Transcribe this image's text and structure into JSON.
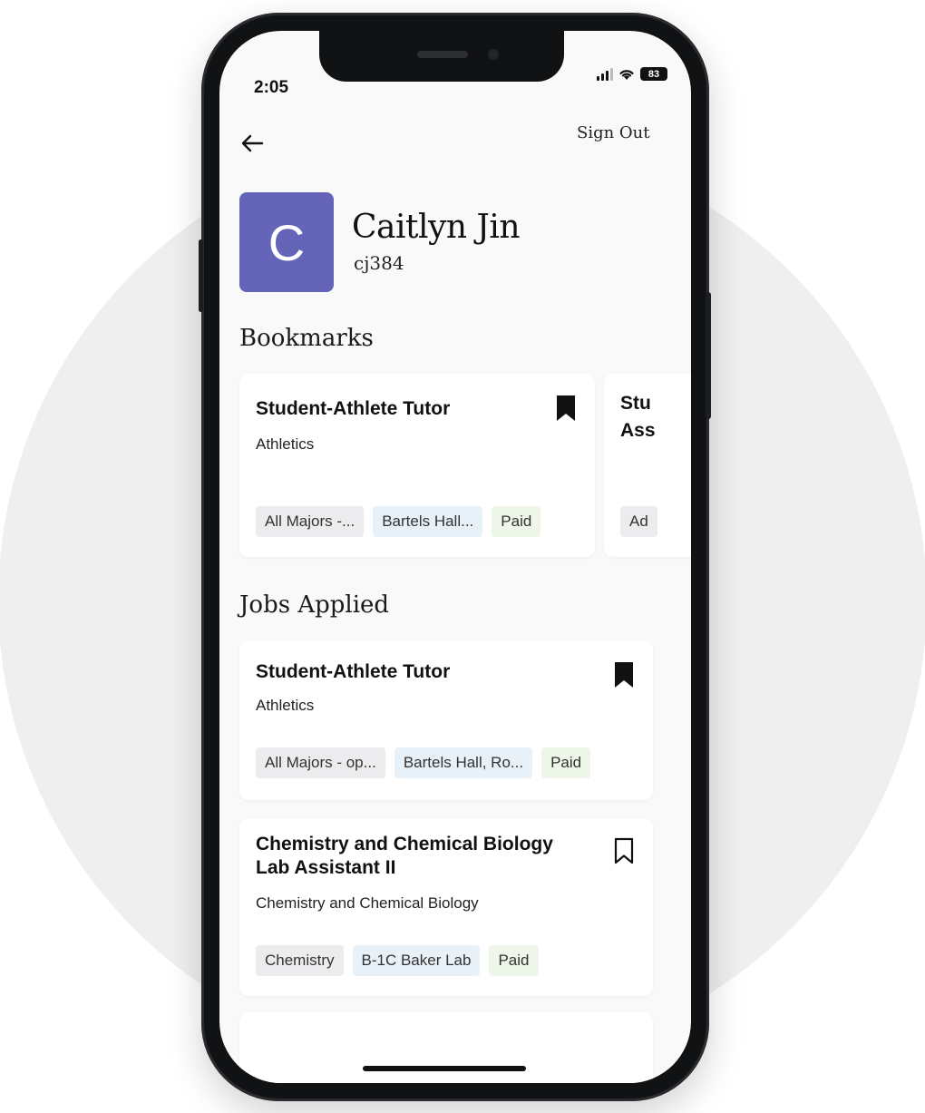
{
  "status_bar": {
    "time": "2:05",
    "battery": "83"
  },
  "header": {
    "sign_out": "Sign Out"
  },
  "profile": {
    "initial": "C",
    "name": "Caitlyn Jin",
    "netid": "cj384",
    "avatar_color": "#6465b8"
  },
  "bookmarks": {
    "title": "Bookmarks",
    "cards": [
      {
        "title": "Student-Athlete Tutor",
        "dept": "Athletics",
        "tags": [
          "All Majors -...",
          "Bartels Hall...",
          "Paid"
        ],
        "bookmarked": true
      },
      {
        "title_line1": "Stu",
        "title_line2": "Ass",
        "tag": "Ad"
      }
    ]
  },
  "jobs_applied": {
    "title": "Jobs Applied",
    "cards": [
      {
        "title": "Student-Athlete Tutor",
        "dept": "Athletics",
        "tags": [
          "All Majors - op...",
          "Bartels Hall, Ro...",
          "Paid"
        ],
        "bookmarked": true
      },
      {
        "title_line1": "Chemistry and Chemical Biology",
        "title_line2": "Lab Assistant II",
        "dept": "Chemistry and Chemical Biology",
        "tags": [
          "Chemistry",
          "B-1C Baker Lab",
          "Paid"
        ],
        "bookmarked": false
      }
    ]
  },
  "icons": [
    "back-arrow-icon",
    "bookmark-filled-icon",
    "bookmark-outline-icon",
    "signal-icon",
    "wifi-icon",
    "battery-icon"
  ]
}
